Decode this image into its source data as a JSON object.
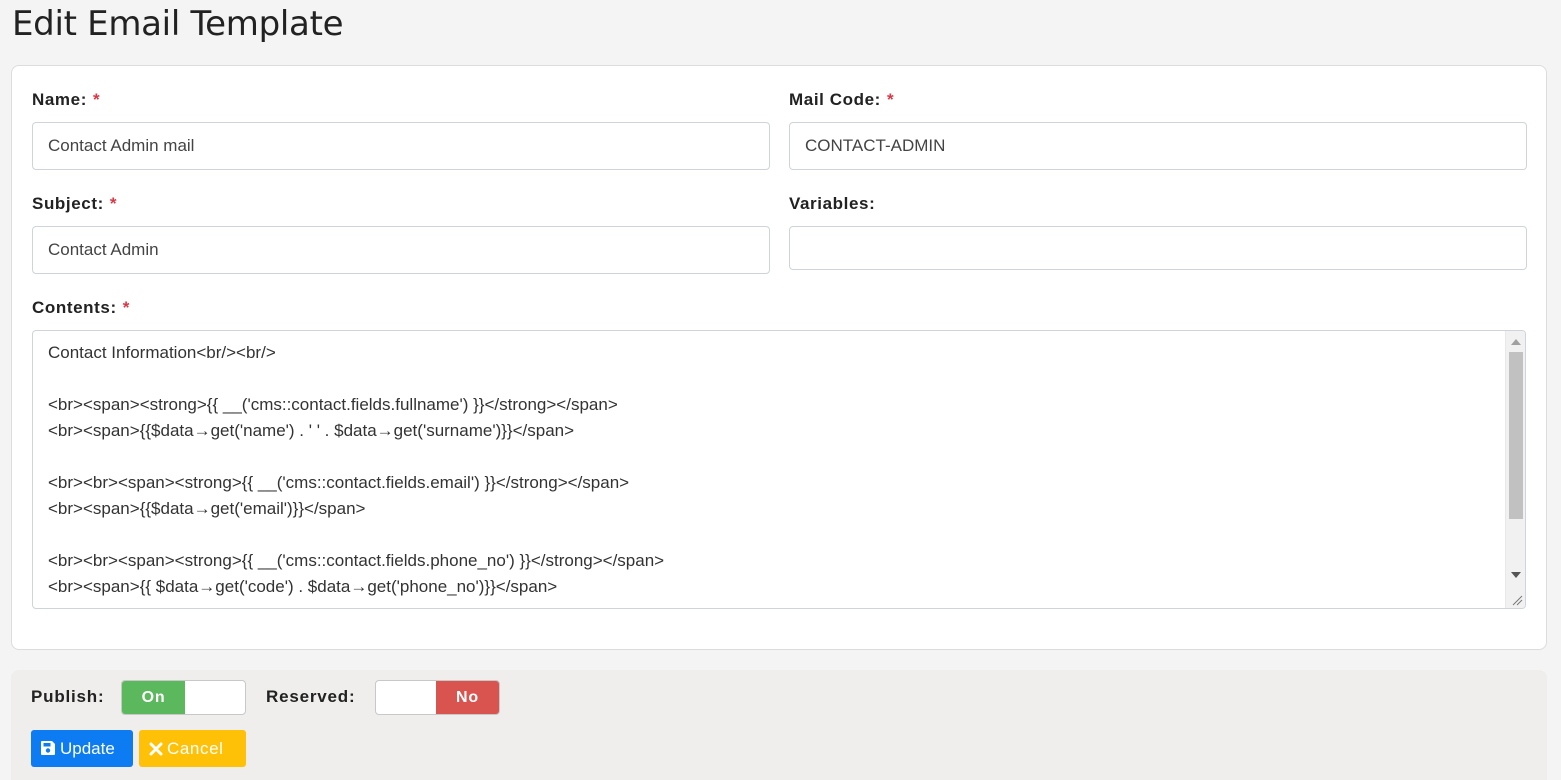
{
  "page": {
    "title": "Edit Email Template"
  },
  "form": {
    "name": {
      "label": "Name:",
      "required": "*",
      "value": "Contact Admin mail"
    },
    "mail_code": {
      "label": "Mail Code:",
      "required": "*",
      "value": "CONTACT-ADMIN"
    },
    "subject": {
      "label": "Subject:",
      "required": "*",
      "value": "Contact Admin"
    },
    "variables": {
      "label": "Variables:",
      "value": ""
    },
    "contents": {
      "label": "Contents:",
      "required": "*",
      "lines": [
        "Contact Information<br/><br/>",
        "",
        "<br><span><strong>{{ __('cms::contact.fields.fullname') }}</strong></span>",
        "<br><span>{{$data→get('name') . ' ' . $data→get('surname')}}</span>",
        "",
        "<br><br><span><strong>{{ __('cms::contact.fields.email') }}</strong></span>",
        "<br><span>{{$data→get('email')}}</span>",
        "",
        "<br><br><span><strong>{{ __('cms::contact.fields.phone_no') }}</strong></span>",
        "<br><span>{{ $data→get('code') . $data→get('phone_no')}}</span>"
      ]
    }
  },
  "footer": {
    "publish": {
      "label": "Publish:",
      "state_label": "On"
    },
    "reserved": {
      "label": "Reserved:",
      "state_label": "No"
    },
    "update_label": "Update",
    "cancel_label": "Cancel"
  },
  "colors": {
    "primary": "#0d7cf2",
    "warning": "#ffc107",
    "success": "#5cb85c",
    "danger": "#d9534f",
    "required": "#dc3545"
  }
}
